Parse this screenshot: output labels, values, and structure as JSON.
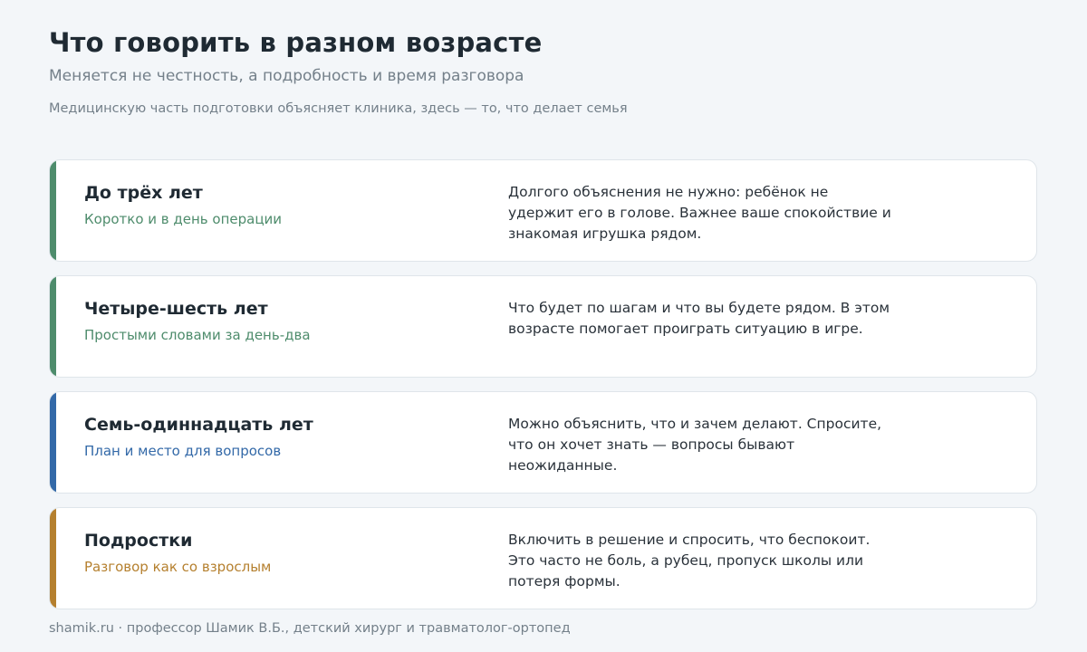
{
  "header": {
    "title": "Что говорить в разном возрасте",
    "subtitle": "Меняется не честность, а подробность и время разговора",
    "note": "Медицинскую часть подготовки объясняет клиника, здесь — то, что делает семья"
  },
  "cards": [
    {
      "age": "До трёх лет",
      "hint": "Коротко и в день операции",
      "description": "Долгого объяснения не нужно: ребёнок не удержит его в голове. Важнее ваше спокойствие и знакомая игрушка рядом.",
      "accent_color": "#4e8c6c"
    },
    {
      "age": "Четыре-шесть лет",
      "hint": "Простыми словами за день-два",
      "description": "Что будет по шагам и что вы будете рядом. В этом возрасте помогает проиграть ситуацию в игре.",
      "accent_color": "#4e8c6c"
    },
    {
      "age": "Семь-одиннадцать лет",
      "hint": "План и место для вопросов",
      "description": "Можно объяснить, что и зачем делают. Спросите, что он хочет знать — вопросы бывают неожиданные.",
      "accent_color": "#3369a8"
    },
    {
      "age": "Подростки",
      "hint": "Разговор как со взрослым",
      "description": "Включить в решение и спросить, что беспокоит. Это часто не боль, а рубец, пропуск школы или потеря формы.",
      "accent_color": "#b5802f"
    }
  ],
  "footer": {
    "text": "shamik.ru · профессор Шамик В.Б., детский хирург и травматолог-ортопед"
  }
}
